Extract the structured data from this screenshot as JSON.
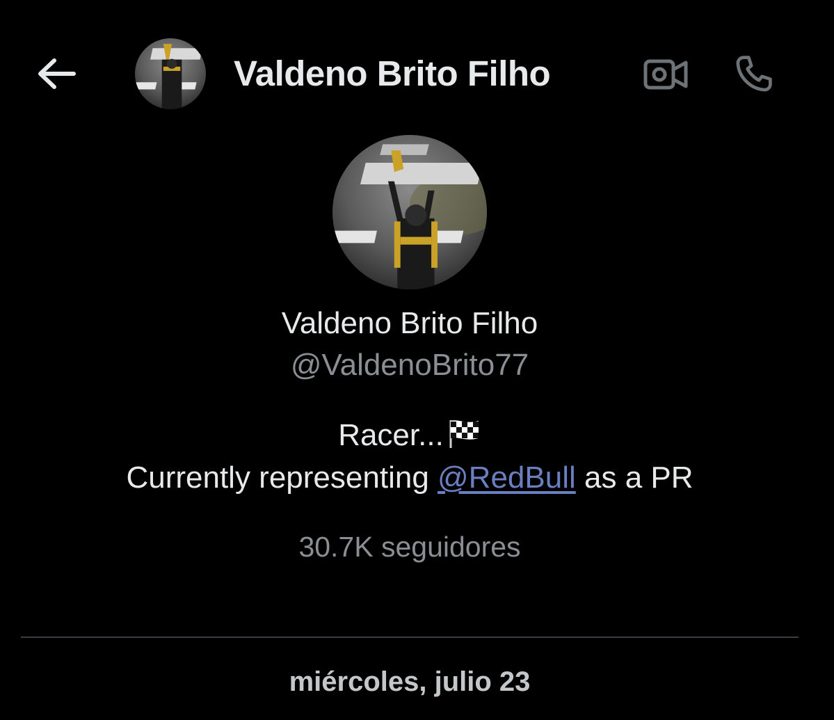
{
  "header": {
    "back_icon": "arrow-left-icon",
    "title": "Valdeno Brito Filho",
    "video_icon": "video-camera-icon",
    "call_icon": "phone-icon"
  },
  "profile": {
    "name": "Valdeno Brito Filho",
    "handle": "@ValdenoBrito77",
    "bio_line1": "Racer...",
    "bio_flag_icon": "checkered-flag-icon",
    "bio_line2_prefix": "Currently representing ",
    "bio_mention": "@RedBull",
    "bio_line2_suffix": " as a PR",
    "followers": "30.7K seguidores"
  },
  "conversation": {
    "date_separator": "miércoles, julio 23"
  },
  "colors": {
    "background": "#000000",
    "primary_text": "#e7e9ea",
    "secondary_text": "#8b8f94",
    "link": "#6b7fc0",
    "icon_muted": "#6e7378"
  }
}
